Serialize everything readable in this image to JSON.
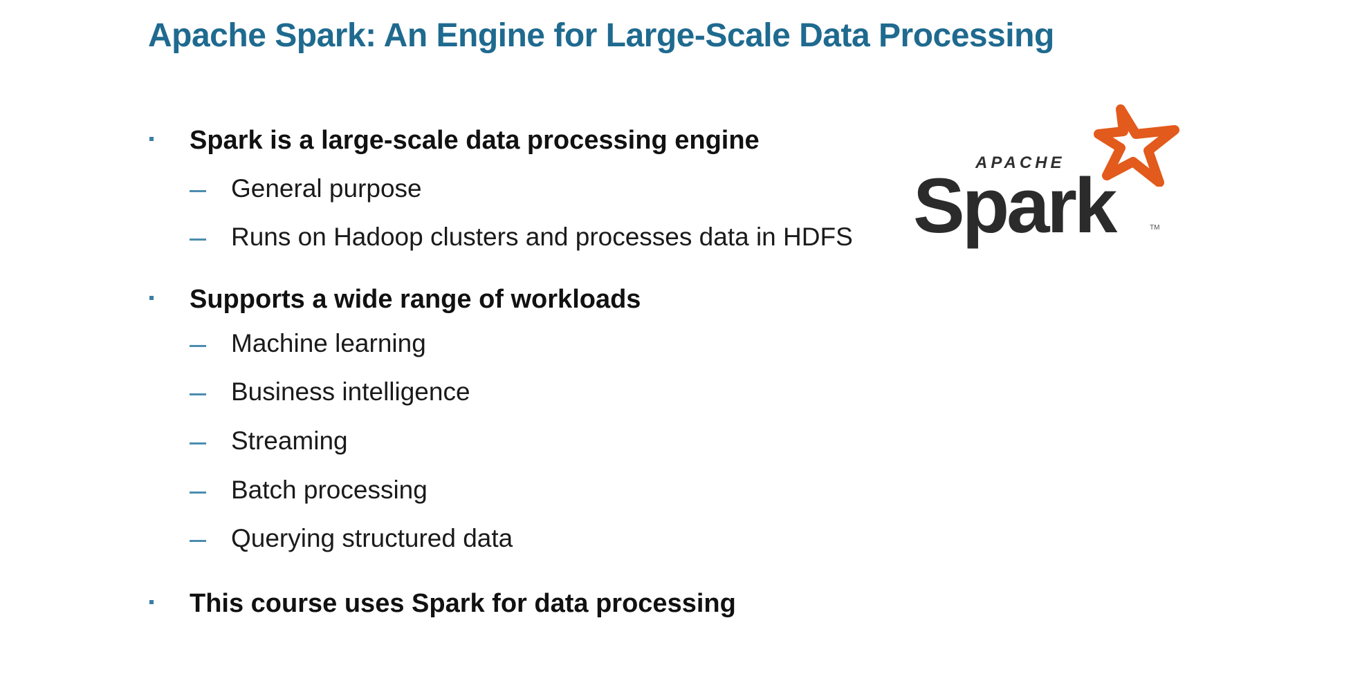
{
  "slide": {
    "title": "Apache Spark: An Engine for Large-Scale Data Processing",
    "bullets": [
      {
        "text": "Spark is a large-scale data processing engine",
        "subs": [
          "General purpose",
          "Runs on Hadoop clusters and processes data in HDFS"
        ]
      },
      {
        "text": "Supports a wide range of workloads",
        "subs": [
          "Machine learning",
          "Business intelligence",
          "Streaming",
          "Batch processing",
          "Querying structured data"
        ]
      },
      {
        "text": "This course uses Spark for data processing",
        "subs": []
      }
    ]
  },
  "logo": {
    "apache": "APACHE",
    "word": "Spark",
    "tm": "TM",
    "star_color": "#e25a1c",
    "text_color": "#2b2b2b"
  },
  "colors": {
    "title": "#1f6a8f",
    "bullet_marker": "#3a7fa3",
    "dash_marker": "#4a8db0"
  }
}
